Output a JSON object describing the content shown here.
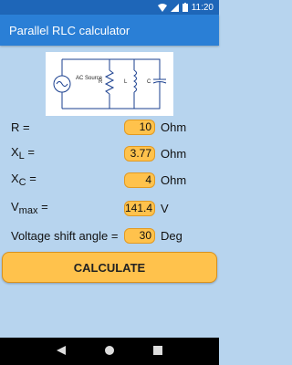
{
  "status_bar": {
    "time": "11:20"
  },
  "app_bar": {
    "title": "Parallel RLC calculator"
  },
  "circuit": {
    "source_label": "AC Source",
    "r_label": "R",
    "l_label": "L",
    "c_label": "C"
  },
  "fields": {
    "r": {
      "label": "R =",
      "value": "10",
      "unit": "Ohm"
    },
    "xl": {
      "label_main": "X",
      "label_sub": "L",
      "label_eq": " =",
      "value": "3.77",
      "unit": "Ohm"
    },
    "xc": {
      "label_main": "X",
      "label_sub": "C",
      "label_eq": " =",
      "value": "4",
      "unit": "Ohm"
    },
    "vmax": {
      "label_main": "V",
      "label_sub": "max",
      "label_eq": " =",
      "value": "141.4",
      "unit": "V"
    },
    "shift": {
      "label": "Voltage shift angle =",
      "value": "30",
      "unit": "Deg"
    }
  },
  "calculate_button": {
    "label": "CALCULATE"
  },
  "colors": {
    "status_bar": "#1e66b8",
    "app_bar": "#2a7fd6",
    "background": "#b7d4ee",
    "accent": "#ffc24c"
  }
}
